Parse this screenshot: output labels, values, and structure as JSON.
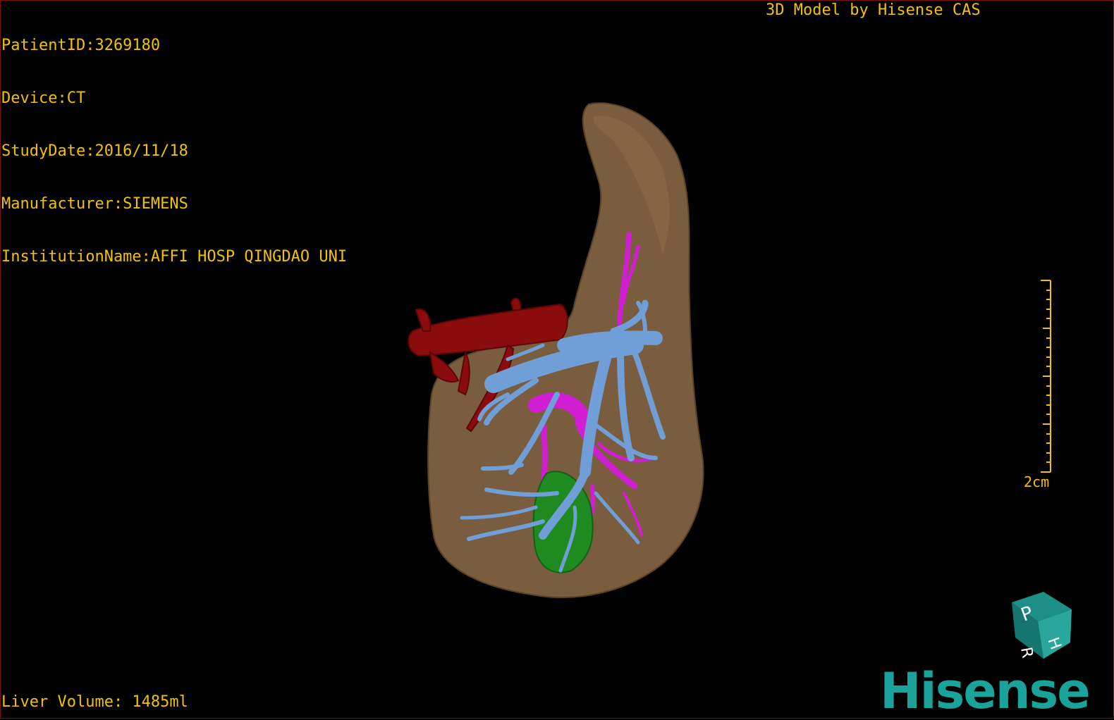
{
  "overlay": {
    "patient_id": "PatientID:3269180",
    "device": "Device:CT",
    "study_date": "StudyDate:2016/11/18",
    "manufacturer": "Manufacturer:SIEMENS",
    "institution": "InstitutionName:AFFI HOSP QINGDAO UNI",
    "credit": "3D Model by Hisense CAS",
    "liver_volume": "Liver Volume: 1485ml"
  },
  "scale_bar": {
    "label": "2cm"
  },
  "orientation_cube": {
    "face_top": "P",
    "face_right": "H",
    "face_bottom": "R"
  },
  "brand": {
    "logo_text": "Hisense",
    "color": "#1aa39a"
  },
  "colors": {
    "text": "#f2c200",
    "liver": "#7a5c3e",
    "artery": "#8a0c0c",
    "portal_vein": "#6f9fd6",
    "bile_duct": "#d21ed2",
    "tumor": "#1f8a1f"
  }
}
